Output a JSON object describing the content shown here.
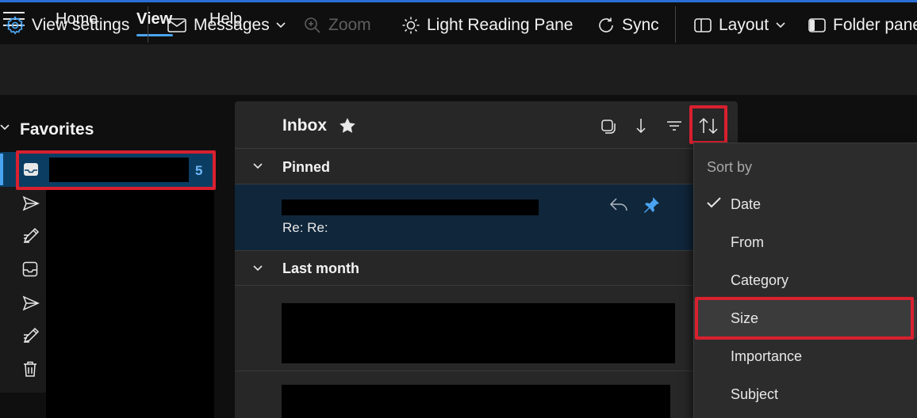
{
  "menu": {
    "tabs": [
      {
        "label": "Home",
        "active": false
      },
      {
        "label": "View",
        "active": true
      },
      {
        "label": "Help",
        "active": false
      }
    ]
  },
  "ribbon": {
    "view_settings": "View settings",
    "messages": "Messages",
    "zoom": "Zoom",
    "light_reading_pane": "Light Reading Pane",
    "sync": "Sync",
    "layout": "Layout",
    "folder_pane": "Folder pane"
  },
  "nav": {
    "favorites_label": "Favorites",
    "selected_folder_count": "5"
  },
  "list": {
    "title": "Inbox",
    "groups": {
      "pinned": "Pinned",
      "last_month": "Last month"
    },
    "pinned_message": {
      "subject": "Re: Re:"
    }
  },
  "sort_menu": {
    "header": "Sort by",
    "items": [
      {
        "label": "Date",
        "checked": true
      },
      {
        "label": "From",
        "checked": false
      },
      {
        "label": "Category",
        "checked": false
      },
      {
        "label": "Size",
        "checked": false,
        "highlighted": true
      },
      {
        "label": "Importance",
        "checked": false
      },
      {
        "label": "Subject",
        "checked": false
      }
    ]
  },
  "colors": {
    "accent": "#4aa3f0",
    "selected_bg": "#0b3d63",
    "highlight_border": "#d9202f",
    "pinned_row_bg": "#10263a"
  }
}
